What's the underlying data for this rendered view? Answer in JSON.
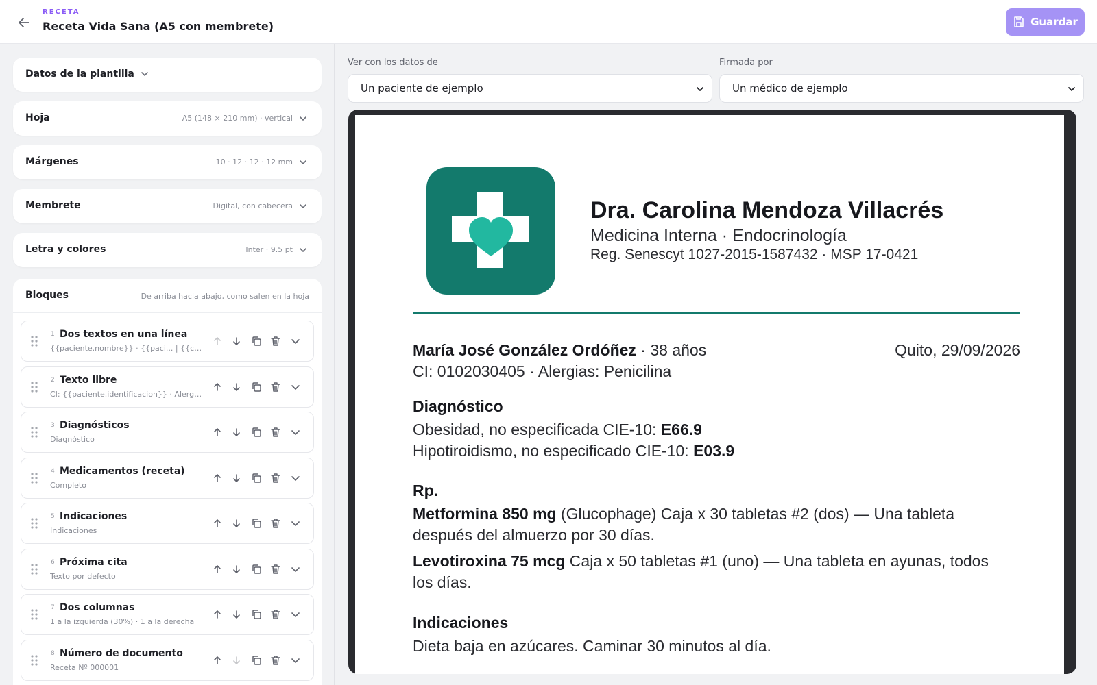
{
  "header": {
    "eyebrow": "RECETA",
    "title": "Receta Vida Sana (A5 con membrete)",
    "save_label": "Guardar"
  },
  "settings": {
    "template_data_label": "Datos de la plantilla",
    "sheet": {
      "label": "Hoja",
      "value": "A5 (148 × 210 mm) · vertical"
    },
    "margins": {
      "label": "Márgenes",
      "value": "10 · 12 · 12 · 12 mm"
    },
    "letterhead": {
      "label": "Membrete",
      "value": "Digital, con cabecera"
    },
    "font": {
      "label": "Letra y colores",
      "value": "Inter · 9.5 pt"
    }
  },
  "blocks": {
    "title": "Bloques",
    "hint": "De arriba hacia abajo, como salen en la hoja",
    "items": [
      {
        "num": "1",
        "name": "Dos textos en una línea",
        "sub": "{{paciente.nombre}} · {{paci... | {{clinic..."
      },
      {
        "num": "2",
        "name": "Texto libre",
        "sub": "CI: {{paciente.identificacion}} · Alergi..."
      },
      {
        "num": "3",
        "name": "Diagnósticos",
        "sub": "Diagnóstico"
      },
      {
        "num": "4",
        "name": "Medicamentos (receta)",
        "sub": "Completo"
      },
      {
        "num": "5",
        "name": "Indicaciones",
        "sub": "Indicaciones"
      },
      {
        "num": "6",
        "name": "Próxima cita",
        "sub": "Texto por defecto"
      },
      {
        "num": "7",
        "name": "Dos columnas",
        "sub": "1 a la izquierda (30%) · 1 a la derecha"
      },
      {
        "num": "8",
        "name": "Número de documento",
        "sub": "Receta Nº 000001"
      }
    ]
  },
  "preview": {
    "patient_select": {
      "label": "Ver con los datos de",
      "value": "Un paciente de ejemplo"
    },
    "doctor_select": {
      "label": "Firmada por",
      "value": "Un médico de ejemplo"
    }
  },
  "document": {
    "doctor_name": "Dra. Carolina Mendoza Villacrés",
    "specialty": "Medicina Interna · Endocrinología",
    "registration": "Reg. Senescyt 1027-2015-1587432 · MSP 17-0421",
    "patient_name": "María José González Ordóñez",
    "patient_age": " · 38 años",
    "place_date": "Quito, 29/09/2026",
    "patient_id_line": "CI: 0102030405 · Alergias: Penicilina",
    "diagnosis_title": "Diagnóstico",
    "diagnoses": [
      {
        "text": "Obesidad, no especificada  CIE-10: ",
        "code": "E66.9"
      },
      {
        "text": "Hipotiroidismo, no especificado  CIE-10: ",
        "code": "E03.9"
      }
    ],
    "rx_title": "Rp.",
    "medications": [
      {
        "name": "Metformina 850 mg",
        "line1_rest": " (Glucophage) Caja x 30 tabletas #2 (dos) — Una tableta",
        "line2": "después del almuerzo por 30 días."
      },
      {
        "name": "Levotiroxina 75 mcg",
        "line1_rest": " Caja x 50 tabletas #1 (uno) — Una tableta en ayunas, todos",
        "line2": "los días."
      }
    ],
    "indications_title": "Indicaciones",
    "indications": "Dieta baja en azúcares. Caminar 30 minutos al día."
  },
  "colors": {
    "accent": "#8b5cf6",
    "save_button": "#a593f5",
    "letterhead_teal": "#137a6c",
    "heart": "#22b8a0"
  }
}
